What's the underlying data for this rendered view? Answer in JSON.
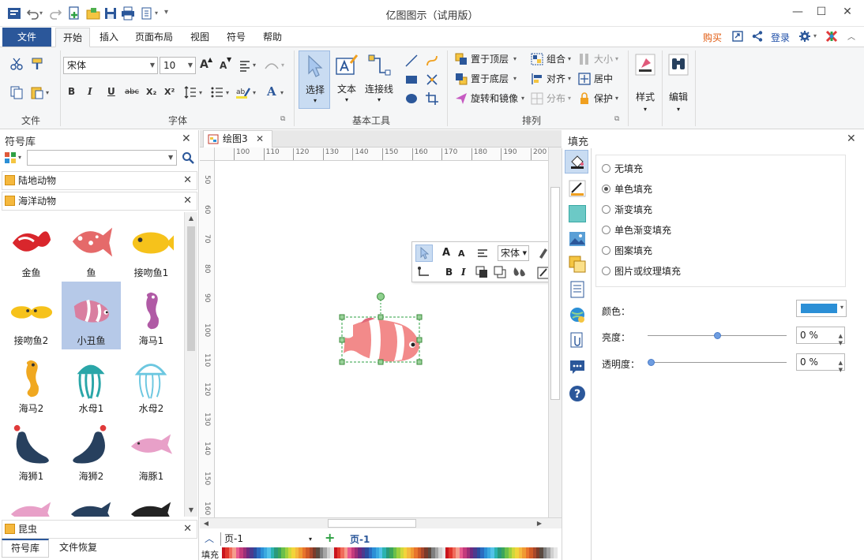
{
  "window": {
    "title": "亿图图示（试用版）",
    "minimize_glyph": "—",
    "maximize_glyph": "☐",
    "close_glyph": "✕"
  },
  "ribbon_tabs": {
    "file": "文件",
    "items": [
      "开始",
      "插入",
      "页面布局",
      "视图",
      "符号",
      "帮助"
    ],
    "active": "开始",
    "buy": "购买",
    "login": "登录"
  },
  "ribbon": {
    "file_group": {
      "label": "文件"
    },
    "font_group": {
      "label": "字体",
      "font_name": "宋体",
      "font_size": "10",
      "grow_font": "A",
      "shrink_font": "A",
      "bold": "B",
      "italic": "I",
      "underline": "U",
      "strike": "abc",
      "subscript": "X₂",
      "superscript": "X²",
      "font_color": "A"
    },
    "basic_tools": {
      "label": "基本工具",
      "select": "选择",
      "text": "文本",
      "connector": "连接线"
    },
    "arrange": {
      "label": "排列",
      "bring_front": "置于顶层",
      "send_back": "置于底层",
      "rotate_mirror": "旋转和镜像",
      "group": "组合",
      "align": "对齐",
      "distribute": "分布",
      "size": "大小",
      "center": "居中",
      "protect": "保护"
    },
    "style": {
      "label": "样式"
    },
    "edit": {
      "label": "编辑"
    }
  },
  "left_panel": {
    "title": "符号库",
    "search_placeholder": "",
    "libraries": [
      "陆地动物",
      "海洋动物"
    ],
    "bottom_library": "昆虫",
    "shapes": [
      {
        "label": "金鱼",
        "color": "#d9262c"
      },
      {
        "label": "鱼",
        "color": "#e56a6a"
      },
      {
        "label": "接吻鱼1",
        "color": "#f6c21b"
      },
      {
        "label": "接吻鱼2",
        "color": "#f6c21b"
      },
      {
        "label": "小丑鱼",
        "color": "#d97fa0",
        "selected": true
      },
      {
        "label": "海马1",
        "color": "#b05aa5"
      },
      {
        "label": "海马2",
        "color": "#f0a820"
      },
      {
        "label": "水母1",
        "color": "#2aa6a8"
      },
      {
        "label": "水母2",
        "color": "#6cc7e0"
      },
      {
        "label": "海狮1",
        "color": "#27405e"
      },
      {
        "label": "海狮2",
        "color": "#27405e"
      },
      {
        "label": "海豚1",
        "color": "#e8a0c8"
      }
    ],
    "bottom_tabs": [
      "符号库",
      "文件恢复"
    ]
  },
  "document": {
    "tab_name": "绘图3",
    "hruler_ticks": [
      "100",
      "110",
      "120",
      "130",
      "140",
      "150",
      "160",
      "170",
      "180",
      "190",
      "200"
    ],
    "vruler_ticks": [
      "50",
      "60",
      "70",
      "80",
      "90",
      "100",
      "110",
      "120",
      "130",
      "140",
      "150",
      "160"
    ],
    "page_select": "页-1",
    "page_tab": "页-1",
    "fill_label": "填充",
    "mini_font": "宋体"
  },
  "fill_panel": {
    "title": "填充",
    "options": [
      "无填充",
      "单色填充",
      "渐变填充",
      "单色渐变填充",
      "图案填充",
      "图片或纹理填充"
    ],
    "selected": "单色填充",
    "color_label": "颜色：",
    "color_value": "#2b8fd6",
    "brightness_label": "亮度：",
    "brightness_value": "0 %",
    "transparency_label": "透明度：",
    "transparency_value": "0 %"
  },
  "palette_colors": [
    "#c9141d",
    "#e0362c",
    "#f06b5b",
    "#f59d8d",
    "#e85a8f",
    "#c43a7c",
    "#9b2e77",
    "#6e2a80",
    "#4b3a8e",
    "#2b4da0",
    "#2a6cc0",
    "#2b8fd6",
    "#3aa9e0",
    "#52c2e8",
    "#2bb3b0",
    "#2a9a7a",
    "#3ba55b",
    "#6bbf4a",
    "#9ccf3f",
    "#cfd83a",
    "#f2d43a",
    "#f5b83d",
    "#f09a32",
    "#e8742b",
    "#d05a26",
    "#a8472a",
    "#7a3b2a",
    "#5a4a40",
    "#7f7f7f",
    "#a5a5a5",
    "#cfcfcf",
    "#e6e6e6"
  ]
}
